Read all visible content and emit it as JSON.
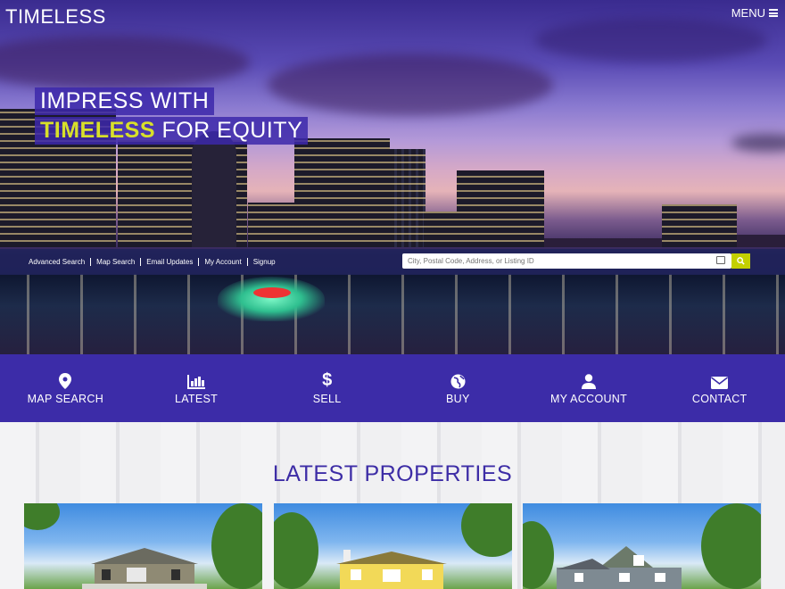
{
  "header": {
    "brand": "TIMELESS",
    "menu_label": "MENU"
  },
  "hero": {
    "line1": "IMPRESS WITH",
    "line2_accent": "TIMELESS",
    "line2_rest": "FOR EQUITY"
  },
  "quick_links": [
    "Advanced Search",
    "Map Search",
    "Email Updates",
    "My Account",
    "Signup"
  ],
  "search": {
    "placeholder": "City, Postal Code, Address, or Listing ID"
  },
  "nav": [
    {
      "label": "MAP SEARCH",
      "icon": "map-pin-icon"
    },
    {
      "label": "LATEST",
      "icon": "bar-chart-icon"
    },
    {
      "label": "SELL",
      "icon": "dollar-icon"
    },
    {
      "label": "BUY",
      "icon": "globe-icon"
    },
    {
      "label": "MY ACCOUNT",
      "icon": "user-icon"
    },
    {
      "label": "CONTACT",
      "icon": "envelope-icon"
    }
  ],
  "latest": {
    "title": "LATEST PROPERTIES"
  },
  "colors": {
    "accent": "#d8e02a",
    "primary": "#3c2ca8",
    "search_button": "#c3d000"
  }
}
